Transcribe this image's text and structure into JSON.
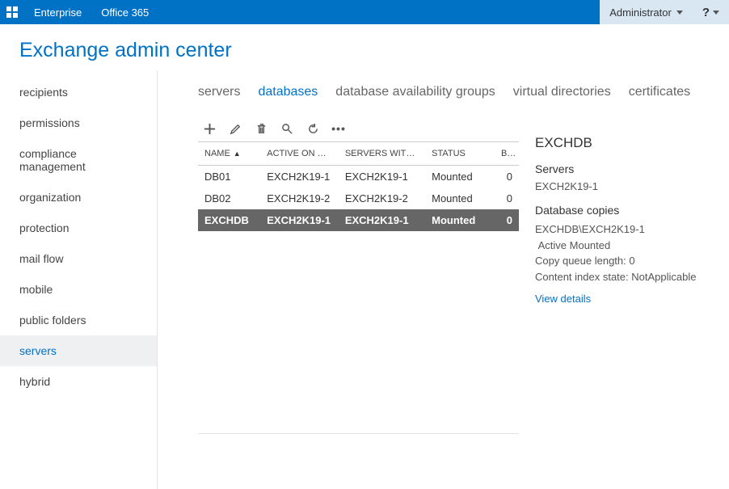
{
  "topbar": {
    "tabs": [
      "Enterprise",
      "Office 365"
    ],
    "user_label": "Administrator",
    "help_label": "?"
  },
  "page_title": "Exchange admin center",
  "sidebar": {
    "items": [
      {
        "label": "recipients"
      },
      {
        "label": "permissions"
      },
      {
        "label": "compliance management"
      },
      {
        "label": "organization"
      },
      {
        "label": "protection"
      },
      {
        "label": "mail flow"
      },
      {
        "label": "mobile"
      },
      {
        "label": "public folders"
      },
      {
        "label": "servers"
      },
      {
        "label": "hybrid"
      }
    ],
    "active_index": 8
  },
  "subtabs": {
    "items": [
      "servers",
      "databases",
      "database availability groups",
      "virtual directories",
      "certificates"
    ],
    "active_index": 1
  },
  "table": {
    "columns": [
      "NAME",
      "ACTIVE ON SE...",
      "SERVERS WITH C...",
      "STATUS",
      "B..."
    ],
    "sort_col": 0,
    "rows": [
      {
        "name": "DB01",
        "active": "EXCH2K19-1",
        "servers": "EXCH2K19-1",
        "status": "Mounted",
        "b": "0"
      },
      {
        "name": "DB02",
        "active": "EXCH2K19-2",
        "servers": "EXCH2K19-2",
        "status": "Mounted",
        "b": "0"
      },
      {
        "name": "EXCHDB",
        "active": "EXCH2K19-1",
        "servers": "EXCH2K19-1",
        "status": "Mounted",
        "b": "0"
      }
    ],
    "selected_index": 2
  },
  "details": {
    "title": "EXCHDB",
    "servers_heading": "Servers",
    "servers_value": "EXCH2K19-1",
    "copies_heading": "Database copies",
    "copy_path": "EXCHDB\\EXCH2K19-1",
    "copy_status": "Active Mounted",
    "copy_queue_label": "Copy queue length:",
    "copy_queue_value": "0",
    "index_state_label": "Content index state:",
    "index_state_value": "NotApplicable",
    "view_details": "View details"
  }
}
